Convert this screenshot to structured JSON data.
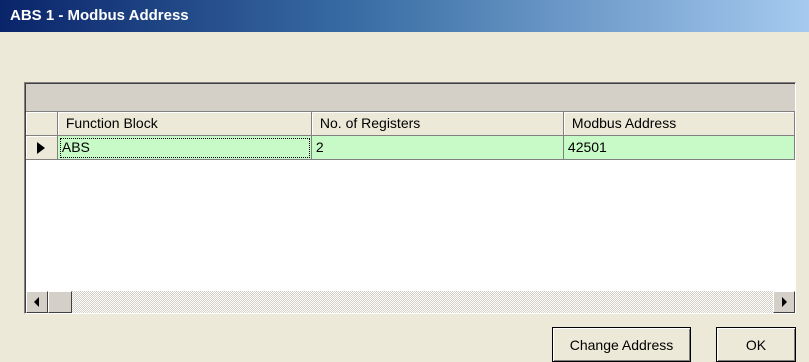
{
  "window": {
    "title": "ABS 1 - Modbus Address"
  },
  "grid": {
    "columns": [
      "Function Block",
      "No. of Registers",
      "Modbus Address"
    ],
    "rows": [
      {
        "function_block": "ABS",
        "registers": "2",
        "address": "42501",
        "selected": true,
        "row_color": "#c8fac8"
      }
    ]
  },
  "icons": {
    "row_indicator": "triangle-right-icon",
    "scroll_left": "triangle-left-icon",
    "scroll_right": "triangle-right-icon"
  },
  "buttons": {
    "change_address": "Change Address",
    "ok": "OK"
  },
  "colors": {
    "dialog_bg": "#ece9d8",
    "selected_row": "#c8fac8",
    "titlebar_start": "#0a246a",
    "titlebar_end": "#a6caf0"
  }
}
